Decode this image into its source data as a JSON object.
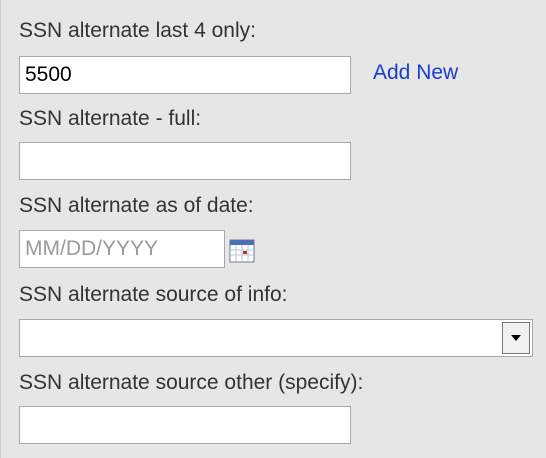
{
  "fields": {
    "ssn_last4": {
      "label": "SSN alternate last 4 only:",
      "value": "5500",
      "add_new_label": "Add New"
    },
    "ssn_full": {
      "label": "SSN alternate - full:",
      "value": ""
    },
    "ssn_as_of_date": {
      "label": "SSN alternate as of date:",
      "placeholder": "MM/DD/YYYY",
      "icon": "calendar-icon"
    },
    "ssn_source": {
      "label": "SSN alternate source of info:",
      "selected": "",
      "icon": "chevron-down-icon"
    },
    "ssn_source_other": {
      "label": "SSN alternate source other (specify):",
      "value": ""
    }
  },
  "colors": {
    "panel_bg": "#e6e6e6",
    "link": "#1a3ccf",
    "label_text": "#333333",
    "placeholder_text": "#9a9a9a"
  }
}
